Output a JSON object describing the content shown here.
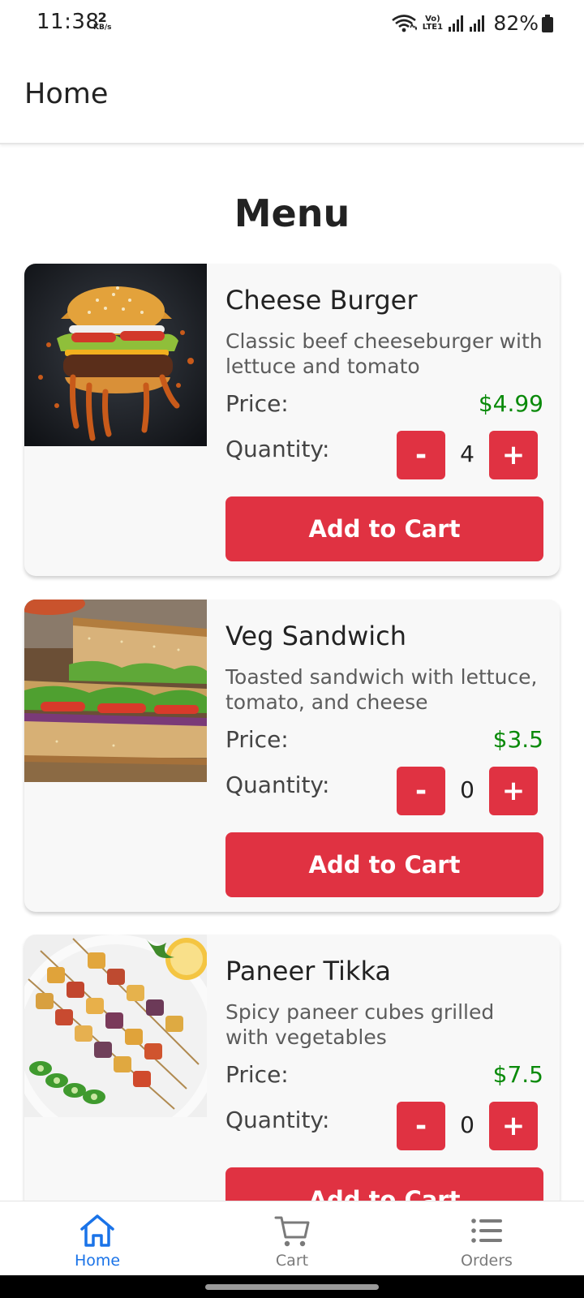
{
  "status_bar": {
    "time": "11:38",
    "speed_value": "2",
    "speed_unit": "KB/s",
    "network_label": "Vo) LTE1",
    "battery": "82%"
  },
  "app_bar": {
    "title": "Home"
  },
  "menu": {
    "title": "Menu",
    "items": [
      {
        "name": "Cheese Burger",
        "description": "Classic beef cheeseburger with lettuce and tomato",
        "price_label": "Price:",
        "price": "$4.99",
        "quantity_label": "Quantity:",
        "quantity": "4",
        "minus": "-",
        "plus": "+",
        "button": "Add to Cart",
        "image": "burger-photo"
      },
      {
        "name": "Veg Sandwich",
        "description": "Toasted sandwich with lettuce, tomato, and cheese",
        "price_label": "Price:",
        "price": "$3.5",
        "quantity_label": "Quantity:",
        "quantity": "0",
        "minus": "-",
        "plus": "+",
        "button": "Add to Cart",
        "image": "sandwich-photo"
      },
      {
        "name": "Paneer Tikka",
        "description": "Spicy paneer cubes grilled with vegetables",
        "price_label": "Price:",
        "price": "$7.5",
        "quantity_label": "Quantity:",
        "quantity": "0",
        "minus": "-",
        "plus": "+",
        "button": "Add to Cart",
        "image": "paneer-tikka-photo"
      }
    ]
  },
  "bottom_nav": {
    "items": [
      {
        "label": "Home",
        "icon": "home-icon",
        "active": true
      },
      {
        "label": "Cart",
        "icon": "cart-icon",
        "active": false
      },
      {
        "label": "Orders",
        "icon": "orders-list-icon",
        "active": false
      }
    ]
  },
  "colors": {
    "accent_red": "#e03242",
    "price_green": "#0a8a0a",
    "nav_active": "#1a73e8",
    "nav_inactive": "#7a7a7a"
  }
}
